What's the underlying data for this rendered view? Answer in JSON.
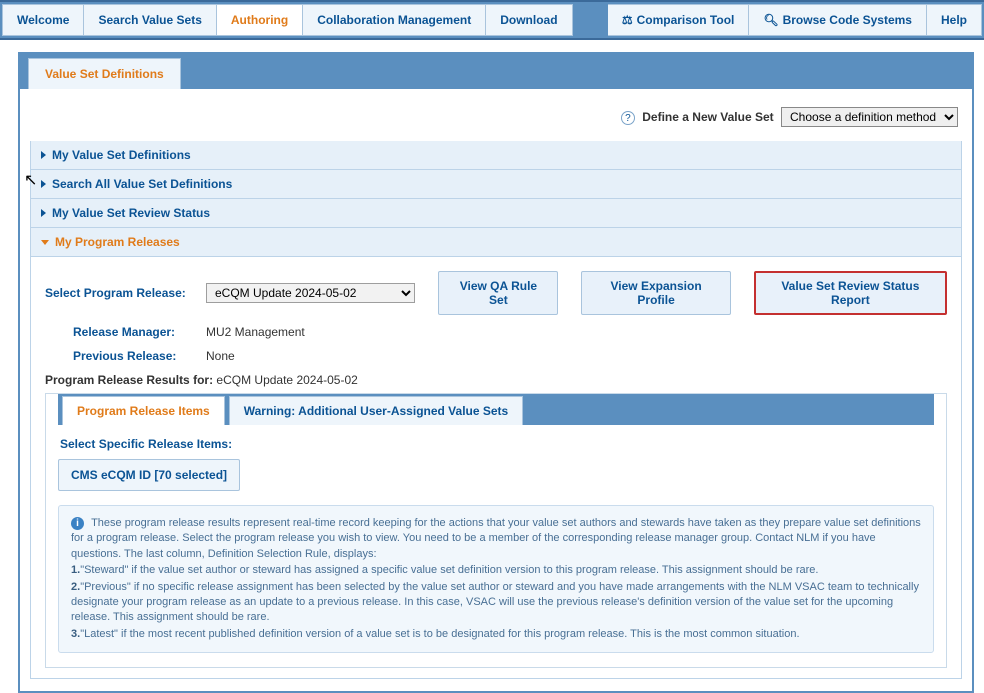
{
  "top_nav": {
    "welcome": "Welcome",
    "search_vs": "Search Value Sets",
    "authoring": "Authoring",
    "collab": "Collaboration Management",
    "download": "Download",
    "comparison": "Comparison Tool",
    "browse_cs": "Browse Code Systems",
    "help": "Help"
  },
  "panel": {
    "tab": "Value Set Definitions",
    "define_label": "Define a New Value Set",
    "define_option": "Choose a definition method"
  },
  "accordion": {
    "my_defs": "My Value Set Definitions",
    "search_all": "Search All Value Set Definitions",
    "review_status": "My Value Set Review Status",
    "program_releases": "My Program Releases"
  },
  "program_releases": {
    "select_label": "Select Program Release:",
    "select_value": "eCQM Update 2024-05-02",
    "btn_qa": "View QA Rule Set",
    "btn_expansion": "View Expansion Profile",
    "btn_status_report": "Value Set Review Status Report",
    "release_manager_label": "Release Manager:",
    "release_manager_value": "MU2 Management",
    "prev_release_label": "Previous Release:",
    "prev_release_value": "None",
    "results_label": "Program Release Results for:",
    "results_value": "eCQM Update 2024-05-02"
  },
  "inner_tabs": {
    "items": "Program Release Items",
    "warning": "Warning: Additional User-Assigned Value Sets"
  },
  "release_items": {
    "select_specific": "Select Specific Release Items:",
    "cms_btn": "CMS eCQM ID [70 selected]"
  },
  "info": {
    "intro": "These program release results represent real-time record keeping for the actions that your value set authors and stewards have taken as they prepare value set definitions for a program release. Select the program release you wish to view. You need to be a member of the corresponding release manager group. Contact NLM if you have questions. The last column, Definition Selection Rule, displays:",
    "r1n": "1.",
    "r1": "\"Steward\" if the value set author or steward has assigned a specific value set definition version to this program release. This assignment should be rare.",
    "r2n": "2.",
    "r2": "\"Previous\" if no specific release assignment has been selected by the value set author or steward and you have made arrangements with the NLM VSAC team to technically designate your program release as an update to a previous release. In this case, VSAC will use the previous release's definition version of the value set for the upcoming release. This assignment should be rare.",
    "r3n": "3.",
    "r3": "\"Latest\" if the most recent published definition version of a value set is to be designated for this program release. This is the most common situation."
  }
}
